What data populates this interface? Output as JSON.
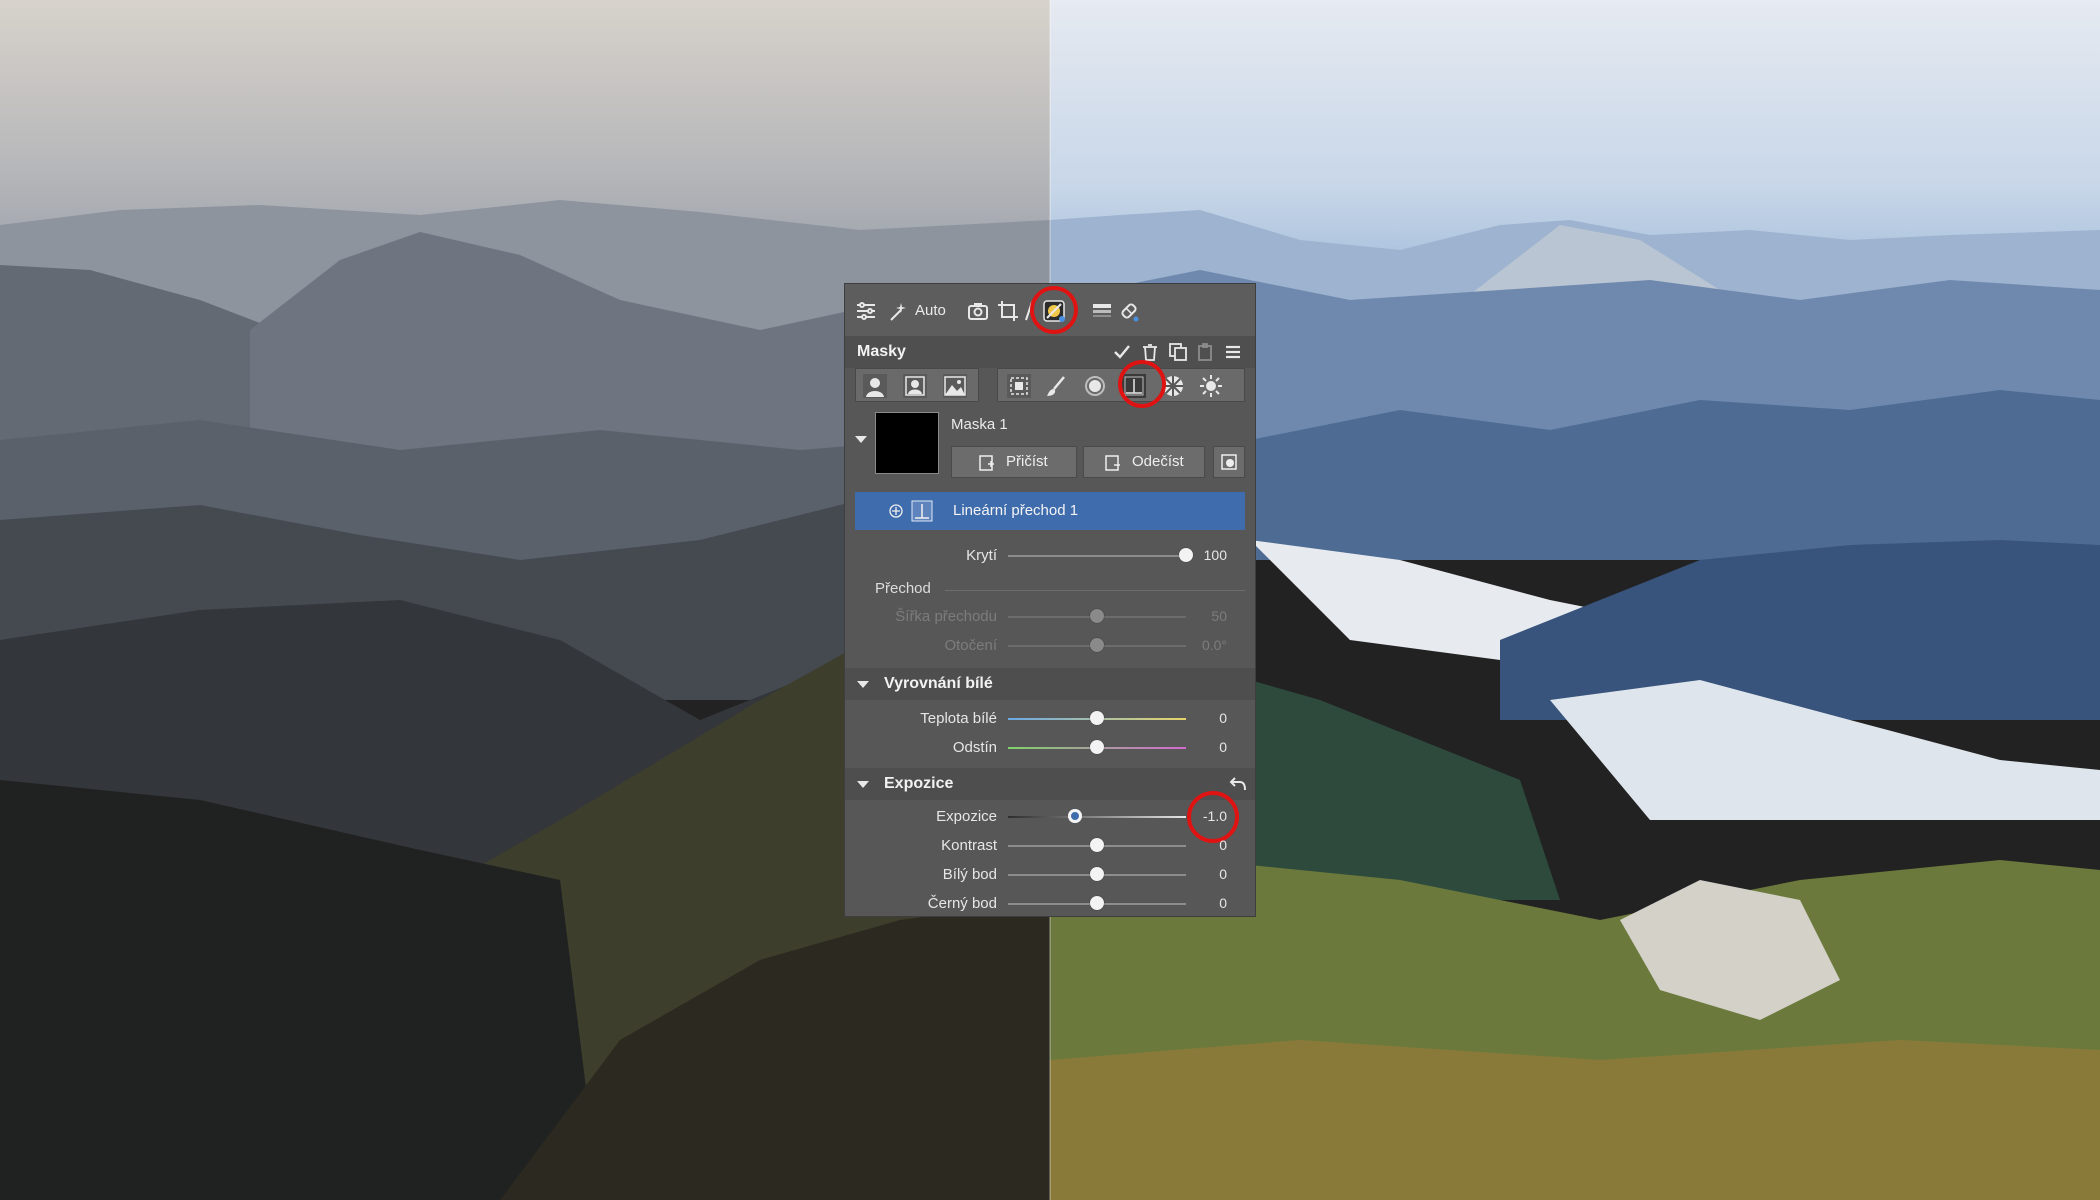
{
  "toolbar": {
    "auto_label": "Auto",
    "icons": [
      "sliders-icon",
      "magic-wand-icon",
      "camera-icon",
      "crop-icon",
      "straighten-icon",
      "masks-icon",
      "gradient-filter-icon",
      "healing-brush-icon"
    ]
  },
  "masks_panel": {
    "title": "Masky",
    "header_icons": [
      "apply-check-icon",
      "delete-icon",
      "copy-icon",
      "paste-icon",
      "menu-icon"
    ],
    "tools": [
      "person-mask-icon",
      "face-mask-icon",
      "sky-mask-icon",
      "select-subject-icon",
      "brush-icon",
      "radial-filter-icon",
      "linear-gradient-icon",
      "color-range-icon",
      "luminosity-mask-icon"
    ],
    "mask": {
      "name": "Maska 1",
      "add_label": "Přičíst",
      "subtract_label": "Odečíst",
      "layer_label": "Lineární přechod 1"
    },
    "opacity": {
      "label": "Krytí",
      "value": "100",
      "level": 1.0
    },
    "gradient": {
      "title": "Přechod",
      "width": {
        "label": "Šířka přechodu",
        "value": "50",
        "level": 0.5
      },
      "rotation": {
        "label": "Otočení",
        "value": "0.0°",
        "level": 0.5
      }
    }
  },
  "white_balance": {
    "title": "Vyrovnání bílé",
    "temperature": {
      "label": "Teplota bílé",
      "value": "0",
      "level": 0.5
    },
    "tint": {
      "label": "Odstín",
      "value": "0",
      "level": 0.5
    }
  },
  "exposure_section": {
    "title": "Expozice",
    "exposure": {
      "label": "Expozice",
      "value": "-1.0",
      "level": 0.375
    },
    "contrast": {
      "label": "Kontrast",
      "value": "0",
      "level": 0.5
    },
    "white_point": {
      "label": "Bílý bod",
      "value": "0",
      "level": 0.5
    },
    "black_point": {
      "label": "Černý bod",
      "value": "0",
      "level": 0.5
    }
  },
  "colors": {
    "highlight": "#e01313",
    "selected_row": "#3f6cad",
    "panel": "#575757"
  }
}
